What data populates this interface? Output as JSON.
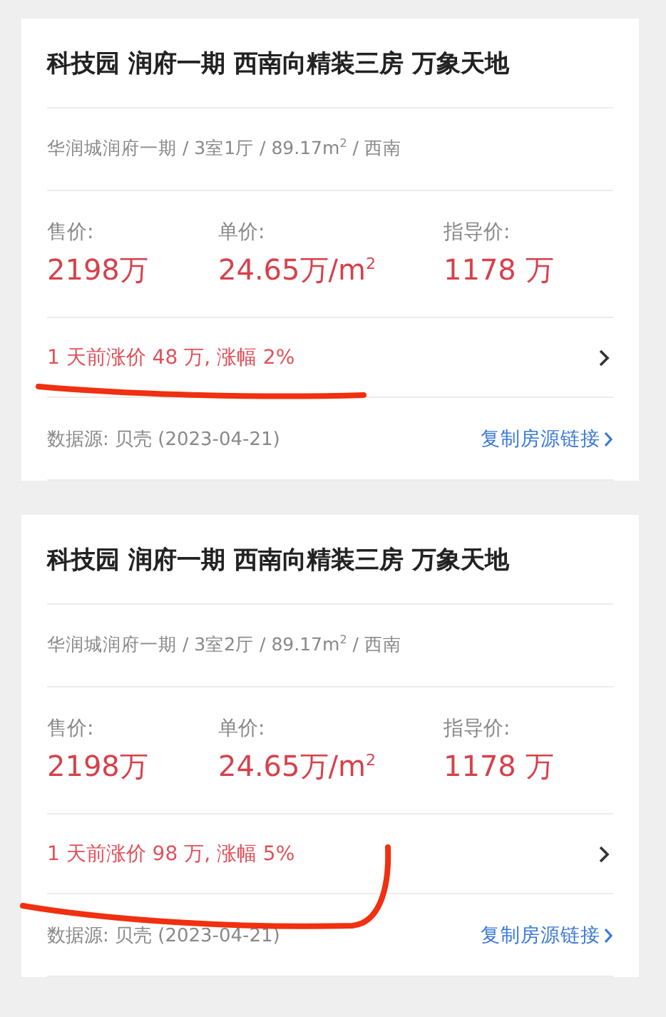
{
  "listings": [
    {
      "title": "科技园 润府一期 西南向精装三房 万象天地",
      "details": "华润城润府一期 / 3室1厅 / 89.17m$^{2}$ / 西南",
      "prices": [
        {
          "label": "售价:",
          "value": "2198万"
        },
        {
          "label": "单价:",
          "value": "24.65万/m$^{2}$"
        },
        {
          "label": "指导价:",
          "value": "1178 万"
        }
      ],
      "change": "1 天前涨价 48 万, 涨幅 2%",
      "source": "数据源: 贝壳 (2023-04-21)",
      "link": "复制房源链接",
      "annotation": {
        "kind": "underline"
      }
    },
    {
      "title": "科技园 润府一期 西南向精装三房 万象天地",
      "details": "华润城润府一期 / 3室2厅 / 89.17m$^{2}$ / 西南",
      "prices": [
        {
          "label": "售价:",
          "value": "2198万"
        },
        {
          "label": "单价:",
          "value": "24.65万/m$^{2}$"
        },
        {
          "label": "指导价:",
          "value": "1178 万"
        }
      ],
      "change": "1 天前涨价 98 万, 涨幅 5%",
      "source": "数据源: 贝壳 (2023-04-21)",
      "link": "复制房源链接",
      "annotation": {
        "kind": "hook"
      }
    }
  ]
}
